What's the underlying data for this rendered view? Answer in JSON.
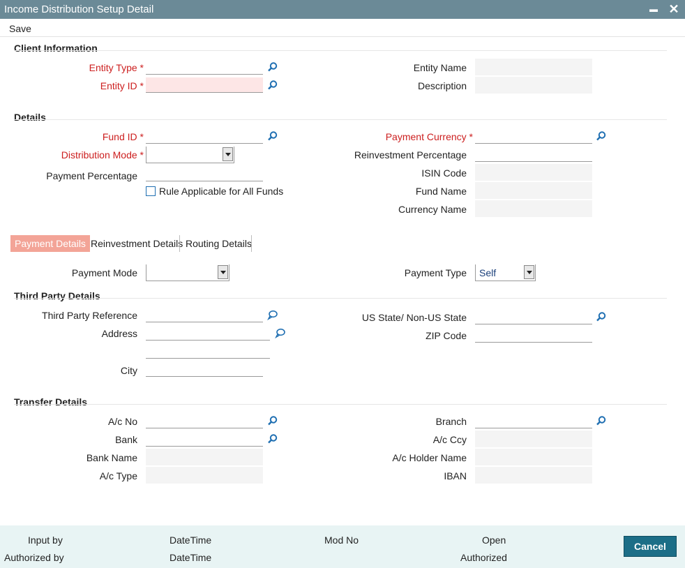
{
  "window": {
    "title": "Income Distribution Setup Detail",
    "minimize": "▬",
    "close": "✕"
  },
  "menu": {
    "save": "Save"
  },
  "client": {
    "section": "Client Information",
    "entity_type": "Entity Type",
    "entity_id": "Entity ID",
    "entity_name": "Entity Name",
    "description": "Description"
  },
  "details": {
    "section": "Details",
    "fund_id": "Fund ID",
    "distribution_mode": "Distribution Mode",
    "payment_percentage": "Payment Percentage",
    "rule_all_funds": "Rule Applicable for All Funds",
    "payment_currency": "Payment Currency",
    "reinvestment_percentage": "Reinvestment Percentage",
    "isin_code": "ISIN Code",
    "fund_name": "Fund Name",
    "currency_name": "Currency Name"
  },
  "tabs": [
    "Payment Details",
    "Reinvestment Details",
    "Routing Details"
  ],
  "payment": {
    "payment_mode": "Payment Mode",
    "payment_type": "Payment Type",
    "payment_type_value": "Self"
  },
  "third_party": {
    "section": "Third Party Details",
    "reference": "Third Party Reference",
    "address": "Address",
    "city": "City",
    "us_state": "US State/ Non-US State",
    "zip": "ZIP Code"
  },
  "transfer": {
    "section": "Transfer Details",
    "ac_no": "A/c No",
    "bank": "Bank",
    "bank_name": "Bank Name",
    "ac_type": "A/c Type",
    "branch": "Branch",
    "ac_ccy": "A/c Ccy",
    "ac_holder": "A/c Holder Name",
    "iban": "IBAN"
  },
  "footer": {
    "input_by": "Input by",
    "authorized_by": "Authorized by",
    "datetime1": "DateTime",
    "datetime2": "DateTime",
    "mod_no": "Mod No",
    "open": "Open",
    "authorized": "Authorized",
    "cancel": "Cancel"
  },
  "colors": {
    "titlebar": "#6b8a97",
    "required": "#cc1e1e",
    "active_tab": "#f3a497",
    "cancel": "#1c6e87",
    "footer": "#e8f4f4"
  }
}
